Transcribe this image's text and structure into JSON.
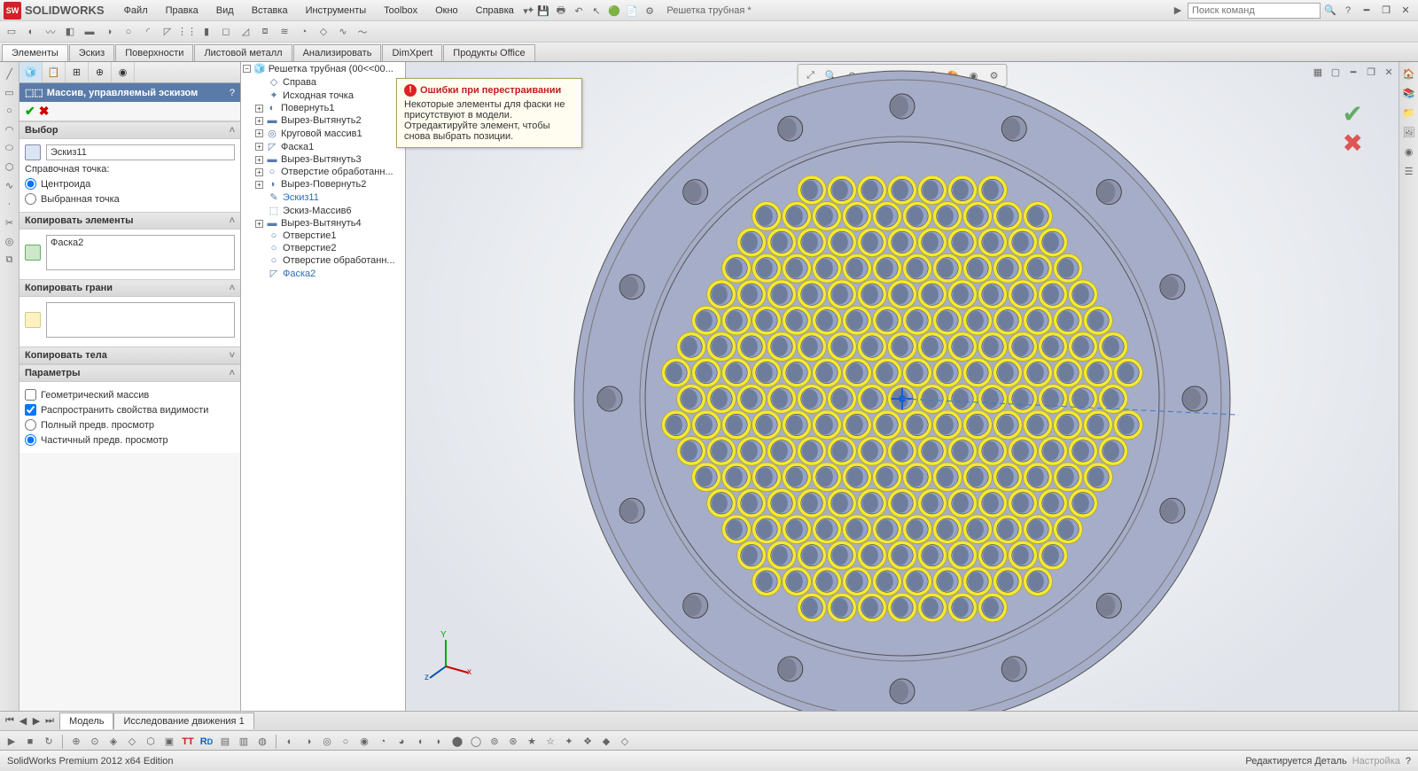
{
  "app": {
    "brand": "SOLIDWORKS",
    "doc_title": "Решетка трубная *"
  },
  "menu": [
    "Файл",
    "Правка",
    "Вид",
    "Вставка",
    "Инструменты",
    "Toolbox",
    "Окно",
    "Справка"
  ],
  "search": {
    "placeholder": "Поиск команд"
  },
  "tabs": [
    "Элементы",
    "Эскиз",
    "Поверхности",
    "Листовой металл",
    "Анализировать",
    "DimXpert",
    "Продукты Office"
  ],
  "active_tab": 0,
  "prop": {
    "title": "Массив, управляемый эскизом",
    "help": "?",
    "sections": {
      "select": {
        "label": "Выбор",
        "value": "Эскиз11",
        "ref_label": "Справочная точка:",
        "radio1": "Центроида",
        "radio2": "Выбранная точка"
      },
      "copy_elems": {
        "label": "Копировать элементы",
        "value": "Фаска2"
      },
      "copy_faces": {
        "label": "Копировать грани"
      },
      "copy_bodies": {
        "label": "Копировать тела"
      },
      "params": {
        "label": "Параметры",
        "geom": "Геометрический массив",
        "vis": "Распространить свойства видимости",
        "full": "Полный предв. просмотр",
        "partial": "Частичный предв. просмотр"
      }
    }
  },
  "tree": {
    "root": "Решетка трубная  (00<<00...",
    "error_feature_visible": true,
    "items": [
      "Справа",
      "Исходная точка",
      "Повернуть1",
      "Вырез-Вытянуть2",
      "Круговой массив1",
      "Фаска1",
      "Вырез-Вытянуть3",
      "Отверстие обработанн...",
      "Вырез-Повернуть2",
      "Эскиз11",
      "Эскиз-Массив6",
      "Вырез-Вытянуть4",
      "Отверстие1",
      "Отверстие2",
      "Отверстие обработанн...",
      "Фаска2"
    ],
    "highlight": [
      9,
      15
    ]
  },
  "tooltip": {
    "title": "Ошибки при перестраивании",
    "body": "Некоторые элементы для фаски не присутствуют в модели.\nОтредактируйте элемент, чтобы снова выбрать позиции."
  },
  "bottom_tabs": [
    "Модель",
    "Исследование движения 1"
  ],
  "status": {
    "left": "SolidWorks Premium 2012 x64 Edition",
    "right": "Редактируется Деталь",
    "settings": "Настройка"
  },
  "triad": {
    "x": "x",
    "y": "Y",
    "z": "z"
  },
  "flange": {
    "outer_r": 370,
    "bolt_r": 330,
    "inner_r": 290,
    "tube_r": 265,
    "tube_spacing": 34,
    "bolt_count": 16,
    "bolt_hole_r": 14
  }
}
